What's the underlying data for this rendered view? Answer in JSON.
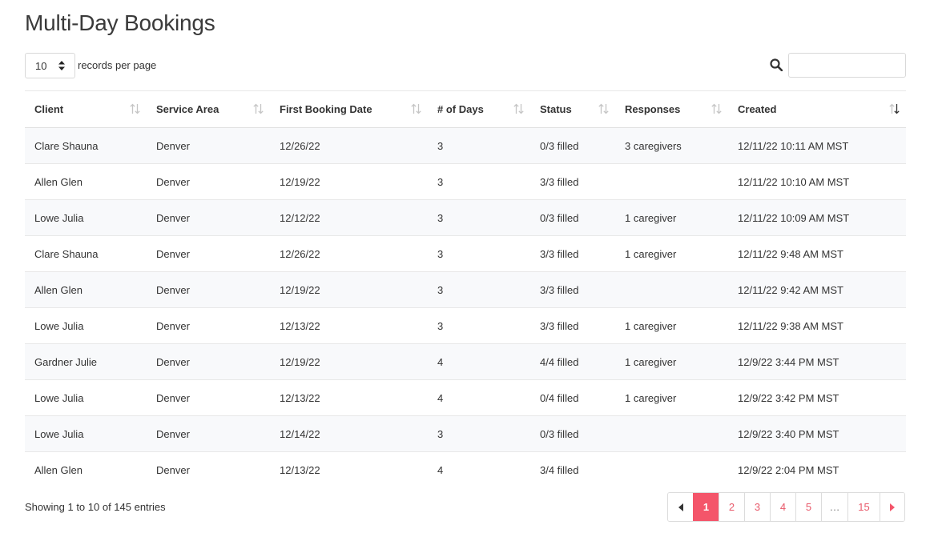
{
  "page_title": "Multi-Day Bookings",
  "length": {
    "value": "10",
    "label": "records per page"
  },
  "search": {
    "placeholder": ""
  },
  "columns": [
    "Client",
    "Service Area",
    "First Booking Date",
    "# of Days",
    "Status",
    "Responses",
    "Created"
  ],
  "rows": [
    [
      "Clare Shauna",
      "Denver",
      "12/26/22",
      "3",
      "0/3 filled",
      "3 caregivers",
      "12/11/22 10:11 AM MST"
    ],
    [
      "Allen Glen",
      "Denver",
      "12/19/22",
      "3",
      "3/3 filled",
      "",
      "12/11/22 10:10 AM MST"
    ],
    [
      "Lowe Julia",
      "Denver",
      "12/12/22",
      "3",
      "0/3 filled",
      "1 caregiver",
      "12/11/22 10:09 AM MST"
    ],
    [
      "Clare Shauna",
      "Denver",
      "12/26/22",
      "3",
      "3/3 filled",
      "1 caregiver",
      "12/11/22 9:48 AM MST"
    ],
    [
      "Allen Glen",
      "Denver",
      "12/19/22",
      "3",
      "3/3 filled",
      "",
      "12/11/22 9:42 AM MST"
    ],
    [
      "Lowe Julia",
      "Denver",
      "12/13/22",
      "3",
      "3/3 filled",
      "1 caregiver",
      "12/11/22 9:38 AM MST"
    ],
    [
      "Gardner Julie",
      "Denver",
      "12/19/22",
      "4",
      "4/4 filled",
      "1 caregiver",
      "12/9/22 3:44 PM MST"
    ],
    [
      "Lowe Julia",
      "Denver",
      "12/13/22",
      "4",
      "0/4 filled",
      "1 caregiver",
      "12/9/22 3:42 PM MST"
    ],
    [
      "Lowe Julia",
      "Denver",
      "12/14/22",
      "3",
      "0/3 filled",
      "",
      "12/9/22 3:40 PM MST"
    ],
    [
      "Allen Glen",
      "Denver",
      "12/13/22",
      "4",
      "3/4 filled",
      "",
      "12/9/22 2:04 PM MST"
    ]
  ],
  "info": "Showing 1 to 10 of 145 entries",
  "pagination": {
    "pages": [
      "1",
      "2",
      "3",
      "4",
      "5",
      "…",
      "15"
    ],
    "active": "1"
  },
  "icons": {
    "search": "search-icon",
    "sort": "sort-icon",
    "sort_desc": "sort-desc-icon",
    "select_caret": "sort-caret-icon",
    "prev": "caret-left-icon",
    "next": "caret-right-icon"
  },
  "colors": {
    "accent": "#f4556a",
    "accent_text": "#e8596a",
    "row_stripe": "#f8f9fb"
  }
}
